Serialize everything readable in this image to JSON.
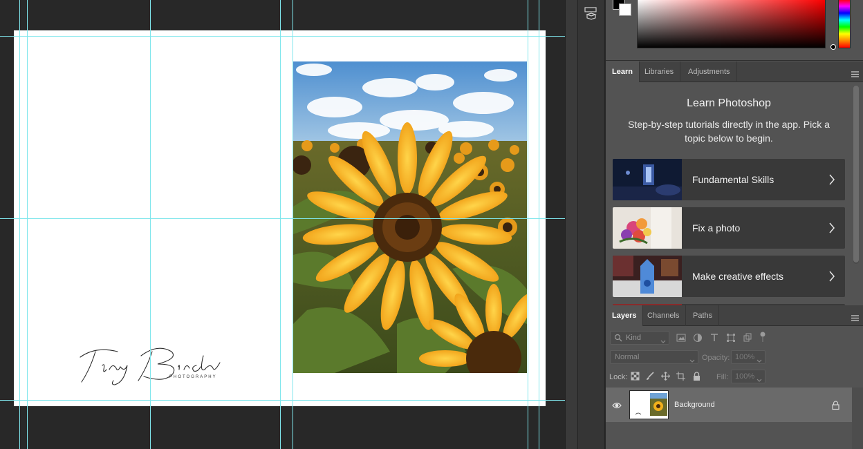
{
  "colors": {
    "guide": "#7fe6ec",
    "workspace": "#282828",
    "panel": "#535353",
    "tab_bar": "#424242"
  },
  "color_panel": {
    "foreground": "#000000",
    "background": "#ffffff"
  },
  "panel_icon": "3d-cube-icon",
  "learn_tabs": [
    {
      "label": "Learn",
      "active": true
    },
    {
      "label": "Libraries",
      "active": false
    },
    {
      "label": "Adjustments",
      "active": false
    }
  ],
  "learn": {
    "title": "Learn Photoshop",
    "description": "Step-by-step tutorials directly in the app. Pick a topic below to begin.",
    "cards": [
      {
        "label": "Fundamental Skills",
        "thumb": "dark-room-scene"
      },
      {
        "label": "Fix a photo",
        "thumb": "flower-bouquet"
      },
      {
        "label": "Make creative effects",
        "thumb": "blue-character-scene"
      }
    ]
  },
  "layers_tabs": [
    {
      "label": "Layers",
      "active": true
    },
    {
      "label": "Channels",
      "active": false
    },
    {
      "label": "Paths",
      "active": false
    }
  ],
  "layers": {
    "kind_placeholder": "Kind",
    "blend_mode": "Normal",
    "opacity_label": "Opacity:",
    "opacity_value": "100%",
    "lock_label": "Lock:",
    "fill_label": "Fill:",
    "fill_value": "100%",
    "items": [
      {
        "name": "Background",
        "visible": true,
        "locked": true
      }
    ]
  },
  "document": {
    "logo_script": "Tiny Birch",
    "logo_sub": "PHOTOGRAPHY",
    "photo": "sunflower-field"
  }
}
